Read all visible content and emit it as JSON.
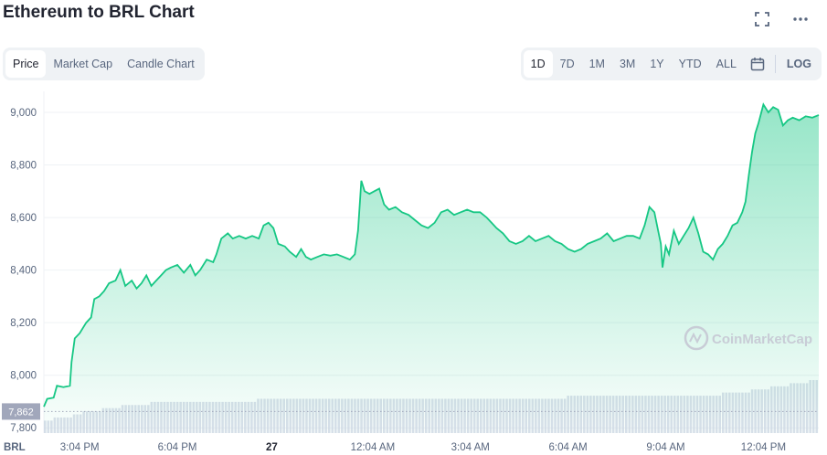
{
  "title": "Ethereum to BRL Chart",
  "icons": {
    "fullscreen": "fullscreen-icon",
    "more": "more-icon",
    "calendar": "calendar-icon",
    "watermark": "coinmarketcap-logo-icon"
  },
  "tabs_left": [
    {
      "label": "Price",
      "active": true
    },
    {
      "label": "Market Cap",
      "active": false
    },
    {
      "label": "Candle Chart",
      "active": false
    }
  ],
  "tabs_right": [
    {
      "label": "1D",
      "active": true
    },
    {
      "label": "7D",
      "active": false
    },
    {
      "label": "1M",
      "active": false
    },
    {
      "label": "3M",
      "active": false
    },
    {
      "label": "1Y",
      "active": false
    },
    {
      "label": "YTD",
      "active": false
    },
    {
      "label": "ALL",
      "active": false
    }
  ],
  "log_label": "LOG",
  "watermark": "CoinMarketCap",
  "colors": {
    "line": "#16c784",
    "fill_top": "#16c784",
    "grid": "#eff2f5",
    "axis_text": "#58667e",
    "volume": "#cfd6e4",
    "badge": "#a1a7bb"
  },
  "chart_data": {
    "type": "area",
    "currency_label": "BRL",
    "current_price_label": "7,862",
    "current_price": 7862,
    "ylim": [
      7780,
      9080
    ],
    "y_ticks": [
      7800,
      8000,
      8200,
      8400,
      8600,
      8800,
      9000
    ],
    "y_tick_labels": [
      "7,800",
      "8,000",
      "8,200",
      "8,400",
      "8,600",
      "8,800",
      "9,000"
    ],
    "x_ticks": [
      {
        "t": 3.1,
        "label": "3:04 PM",
        "bold": false
      },
      {
        "t": 6.1,
        "label": "6:04 PM",
        "bold": false
      },
      {
        "t": 9.0,
        "label": "27",
        "bold": true
      },
      {
        "t": 12.1,
        "label": "12:04 AM",
        "bold": false
      },
      {
        "t": 15.1,
        "label": "3:04 AM",
        "bold": false
      },
      {
        "t": 18.1,
        "label": "6:04 AM",
        "bold": false
      },
      {
        "t": 21.1,
        "label": "9:04 AM",
        "bold": false
      },
      {
        "t": 24.1,
        "label": "12:04 PM",
        "bold": false
      }
    ],
    "xlim": [
      2.0,
      25.8
    ],
    "series": [
      {
        "points": [
          [
            2.0,
            7880
          ],
          [
            2.1,
            7910
          ],
          [
            2.3,
            7915
          ],
          [
            2.4,
            7960
          ],
          [
            2.6,
            7955
          ],
          [
            2.8,
            7960
          ],
          [
            2.85,
            8050
          ],
          [
            2.95,
            8140
          ],
          [
            3.1,
            8160
          ],
          [
            3.3,
            8200
          ],
          [
            3.45,
            8220
          ],
          [
            3.55,
            8290
          ],
          [
            3.7,
            8300
          ],
          [
            3.85,
            8320
          ],
          [
            4.0,
            8350
          ],
          [
            4.2,
            8360
          ],
          [
            4.35,
            8400
          ],
          [
            4.5,
            8340
          ],
          [
            4.7,
            8360
          ],
          [
            4.85,
            8330
          ],
          [
            5.0,
            8350
          ],
          [
            5.15,
            8380
          ],
          [
            5.3,
            8340
          ],
          [
            5.45,
            8360
          ],
          [
            5.6,
            8380
          ],
          [
            5.75,
            8400
          ],
          [
            5.9,
            8410
          ],
          [
            6.1,
            8420
          ],
          [
            6.3,
            8390
          ],
          [
            6.5,
            8420
          ],
          [
            6.65,
            8380
          ],
          [
            6.8,
            8400
          ],
          [
            7.0,
            8440
          ],
          [
            7.2,
            8430
          ],
          [
            7.3,
            8460
          ],
          [
            7.45,
            8520
          ],
          [
            7.65,
            8540
          ],
          [
            7.8,
            8520
          ],
          [
            8.0,
            8530
          ],
          [
            8.2,
            8520
          ],
          [
            8.4,
            8530
          ],
          [
            8.6,
            8520
          ],
          [
            8.75,
            8570
          ],
          [
            8.9,
            8580
          ],
          [
            9.05,
            8560
          ],
          [
            9.2,
            8500
          ],
          [
            9.4,
            8490
          ],
          [
            9.55,
            8470
          ],
          [
            9.75,
            8450
          ],
          [
            9.9,
            8480
          ],
          [
            10.05,
            8450
          ],
          [
            10.2,
            8440
          ],
          [
            10.4,
            8450
          ],
          [
            10.6,
            8460
          ],
          [
            10.8,
            8455
          ],
          [
            11.0,
            8460
          ],
          [
            11.2,
            8450
          ],
          [
            11.4,
            8440
          ],
          [
            11.55,
            8460
          ],
          [
            11.65,
            8550
          ],
          [
            11.75,
            8740
          ],
          [
            11.85,
            8700
          ],
          [
            12.0,
            8690
          ],
          [
            12.15,
            8700
          ],
          [
            12.3,
            8710
          ],
          [
            12.45,
            8650
          ],
          [
            12.6,
            8630
          ],
          [
            12.8,
            8640
          ],
          [
            13.0,
            8620
          ],
          [
            13.2,
            8610
          ],
          [
            13.4,
            8590
          ],
          [
            13.6,
            8570
          ],
          [
            13.8,
            8560
          ],
          [
            14.0,
            8580
          ],
          [
            14.2,
            8620
          ],
          [
            14.4,
            8630
          ],
          [
            14.6,
            8610
          ],
          [
            14.8,
            8620
          ],
          [
            15.0,
            8630
          ],
          [
            15.2,
            8620
          ],
          [
            15.4,
            8620
          ],
          [
            15.6,
            8600
          ],
          [
            15.75,
            8580
          ],
          [
            15.9,
            8560
          ],
          [
            16.1,
            8540
          ],
          [
            16.3,
            8510
          ],
          [
            16.5,
            8500
          ],
          [
            16.7,
            8510
          ],
          [
            16.9,
            8530
          ],
          [
            17.1,
            8510
          ],
          [
            17.3,
            8520
          ],
          [
            17.5,
            8530
          ],
          [
            17.7,
            8510
          ],
          [
            17.9,
            8500
          ],
          [
            18.1,
            8480
          ],
          [
            18.3,
            8470
          ],
          [
            18.5,
            8480
          ],
          [
            18.7,
            8500
          ],
          [
            18.9,
            8510
          ],
          [
            19.1,
            8520
          ],
          [
            19.3,
            8540
          ],
          [
            19.5,
            8510
          ],
          [
            19.7,
            8520
          ],
          [
            19.9,
            8530
          ],
          [
            20.1,
            8530
          ],
          [
            20.3,
            8520
          ],
          [
            20.45,
            8570
          ],
          [
            20.6,
            8640
          ],
          [
            20.75,
            8620
          ],
          [
            20.85,
            8560
          ],
          [
            20.95,
            8500
          ],
          [
            21.0,
            8410
          ],
          [
            21.1,
            8490
          ],
          [
            21.2,
            8460
          ],
          [
            21.35,
            8550
          ],
          [
            21.5,
            8500
          ],
          [
            21.65,
            8530
          ],
          [
            21.8,
            8560
          ],
          [
            21.95,
            8600
          ],
          [
            22.1,
            8540
          ],
          [
            22.25,
            8470
          ],
          [
            22.4,
            8460
          ],
          [
            22.55,
            8440
          ],
          [
            22.7,
            8480
          ],
          [
            22.85,
            8500
          ],
          [
            23.0,
            8530
          ],
          [
            23.15,
            8570
          ],
          [
            23.3,
            8580
          ],
          [
            23.45,
            8620
          ],
          [
            23.55,
            8660
          ],
          [
            23.65,
            8760
          ],
          [
            23.75,
            8850
          ],
          [
            23.85,
            8920
          ],
          [
            23.95,
            8960
          ],
          [
            24.1,
            9030
          ],
          [
            24.25,
            9000
          ],
          [
            24.4,
            9020
          ],
          [
            24.55,
            9010
          ],
          [
            24.7,
            8950
          ],
          [
            24.85,
            8970
          ],
          [
            25.0,
            8980
          ],
          [
            25.2,
            8970
          ],
          [
            25.4,
            8985
          ],
          [
            25.6,
            8980
          ],
          [
            25.8,
            8990
          ]
        ]
      }
    ],
    "volume": {
      "values": [
        4,
        5,
        5,
        6,
        7,
        7,
        8,
        8,
        9,
        9,
        9,
        10,
        10,
        10,
        10,
        10,
        10,
        10,
        10,
        10,
        10,
        10,
        11,
        11,
        11,
        11,
        11,
        11,
        11,
        11,
        11,
        11,
        11,
        11,
        11,
        11,
        11,
        11,
        11,
        11,
        11,
        11,
        11,
        11,
        11,
        11,
        11,
        11,
        11,
        11,
        11,
        11,
        11,
        11,
        12,
        12,
        12,
        12,
        12,
        12,
        12,
        12,
        12,
        12,
        12,
        12,
        12,
        12,
        12,
        12,
        13,
        13,
        13,
        14,
        14,
        15,
        15,
        16,
        16,
        17
      ]
    }
  }
}
